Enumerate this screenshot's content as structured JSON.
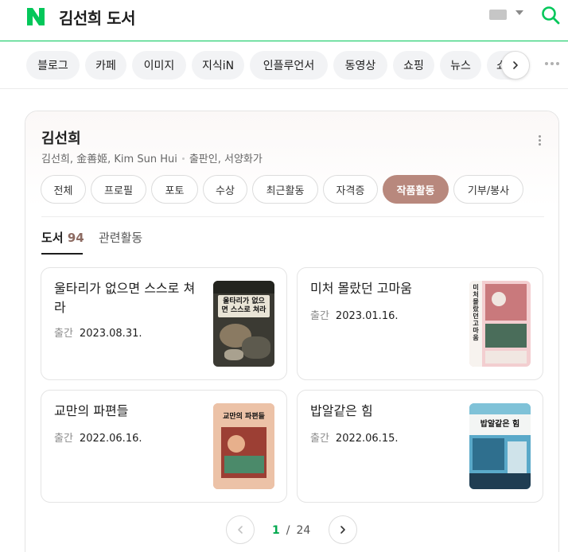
{
  "header": {
    "logo_letter": "N",
    "query": "김선희 도서",
    "colors": {
      "brand": "#03c75a"
    }
  },
  "nav": {
    "items": [
      {
        "label": "블로그"
      },
      {
        "label": "카페"
      },
      {
        "label": "이미지"
      },
      {
        "label": "지식iN"
      },
      {
        "label": "인플루언서"
      },
      {
        "label": "동영상"
      },
      {
        "label": "쇼핑"
      },
      {
        "label": "뉴스"
      },
      {
        "label": "쇼"
      }
    ]
  },
  "profile": {
    "name": "김선희",
    "aliases": "김선희, 金善姬, Kim Sun Hui",
    "roles": "출판인, 서양화가",
    "filters": [
      {
        "label": "전체",
        "active": false
      },
      {
        "label": "프로필",
        "active": false
      },
      {
        "label": "포토",
        "active": false
      },
      {
        "label": "수상",
        "active": false
      },
      {
        "label": "최근활동",
        "active": false
      },
      {
        "label": "자격증",
        "active": false
      },
      {
        "label": "작품활동",
        "active": true
      },
      {
        "label": "기부/봉사",
        "active": false
      }
    ],
    "filter_active_color": "#b8887d"
  },
  "subtabs": {
    "books_label": "도서",
    "books_count": "94",
    "related_label": "관련활동"
  },
  "books": [
    {
      "title": "울타리가 없으면 스스로 쳐라",
      "meta_label": "출간",
      "date": "2023.08.31.",
      "cover_text": "울타리가 없으면 스스로 쳐라"
    },
    {
      "title": "미처 몰랐던 고마움",
      "meta_label": "출간",
      "date": "2023.01.16.",
      "cover_text": "미처 몰랐던 고마움"
    },
    {
      "title": "교만의 파편들",
      "meta_label": "출간",
      "date": "2022.06.16.",
      "cover_text": "교만의 파편들"
    },
    {
      "title": "밥알같은 힘",
      "meta_label": "출간",
      "date": "2022.06.15.",
      "cover_text": "밥알같은 힘"
    }
  ],
  "pagination": {
    "current": "1",
    "separator": "/",
    "total": "24"
  },
  "icons": [
    "naver-logo-icon",
    "keyboard-icon",
    "dropdown-caret-icon",
    "search-icon",
    "chevron-right-icon",
    "chevron-left-icon",
    "more-dots-icon",
    "kebab-menu-icon"
  ]
}
